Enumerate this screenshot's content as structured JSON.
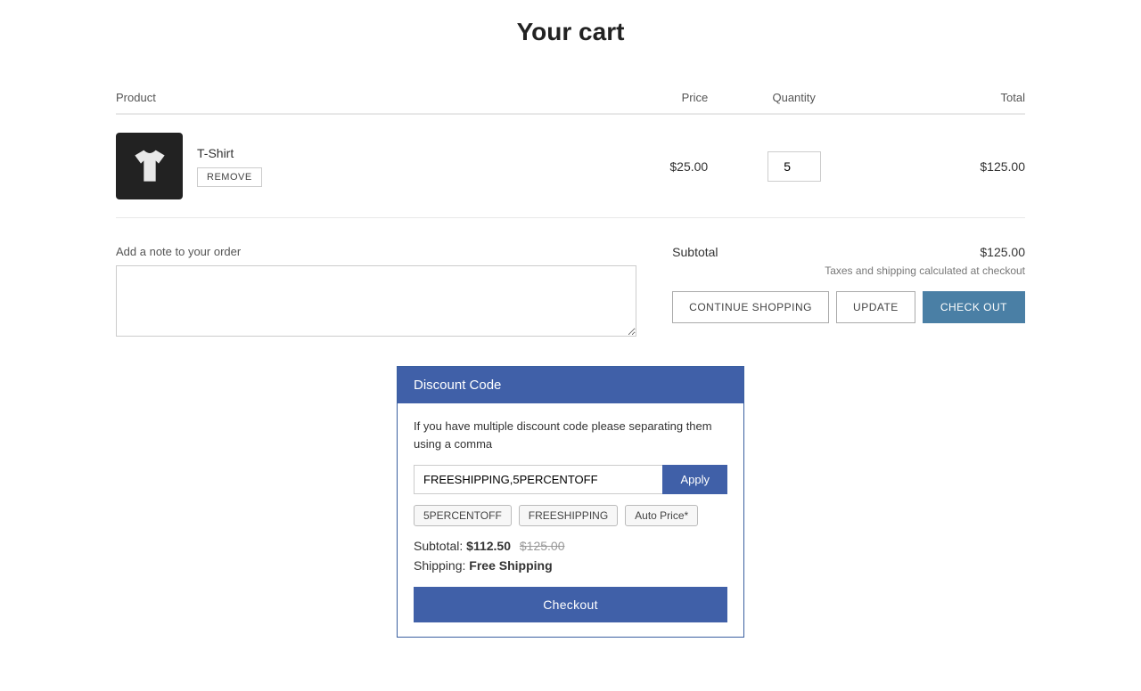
{
  "page": {
    "title": "Your cart"
  },
  "table": {
    "headers": {
      "product": "Product",
      "price": "Price",
      "quantity": "Quantity",
      "total": "Total"
    }
  },
  "cart": {
    "item": {
      "name": "T-Shirt",
      "remove_label": "REMOVE",
      "price": "$25.00",
      "quantity": "5",
      "total": "$125.00"
    }
  },
  "note": {
    "label": "Add a note to your order",
    "placeholder": ""
  },
  "summary": {
    "subtotal_label": "Subtotal",
    "subtotal_value": "$125.00",
    "tax_note": "Taxes and shipping calculated at checkout"
  },
  "buttons": {
    "continue": "CONTINUE SHOPPING",
    "update": "UPDATE",
    "checkout": "CHECK OUT"
  },
  "discount": {
    "header": "Discount Code",
    "instructions": "If you have multiple discount code please separating them using a comma",
    "input_value": "FREESHIPPING,5PERCENTOFF",
    "apply_label": "Apply",
    "tags": [
      "5PERCENTOFF",
      "FREESHIPPING",
      "Auto Price*"
    ],
    "subtotal_label": "Subtotal:",
    "subtotal_new": "$112.50",
    "subtotal_original": "$125.00",
    "shipping_label": "Shipping:",
    "shipping_value": "Free Shipping",
    "checkout_label": "Checkout"
  }
}
